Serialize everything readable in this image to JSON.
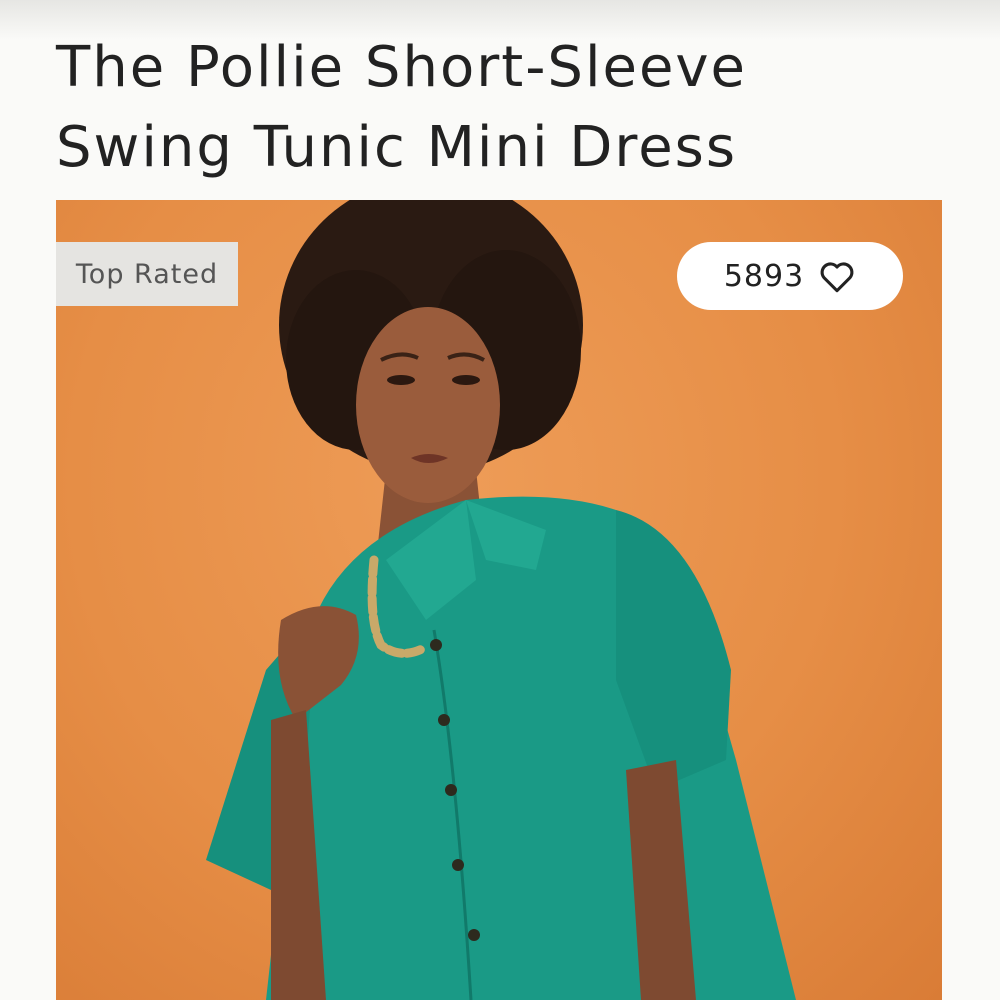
{
  "product": {
    "title": "The Pollie Short-Sleeve Swing Tunic Mini Dress",
    "badge": "Top Rated",
    "like_count": "5893"
  },
  "icons": {
    "favorite": "heart-outline-icon"
  },
  "colors": {
    "background": "#fafaf8",
    "photo_backdrop": "#e68e46",
    "dress": "#1a9a86",
    "badge_bg": "#e5e4e1",
    "pill_bg": "#ffffff"
  }
}
